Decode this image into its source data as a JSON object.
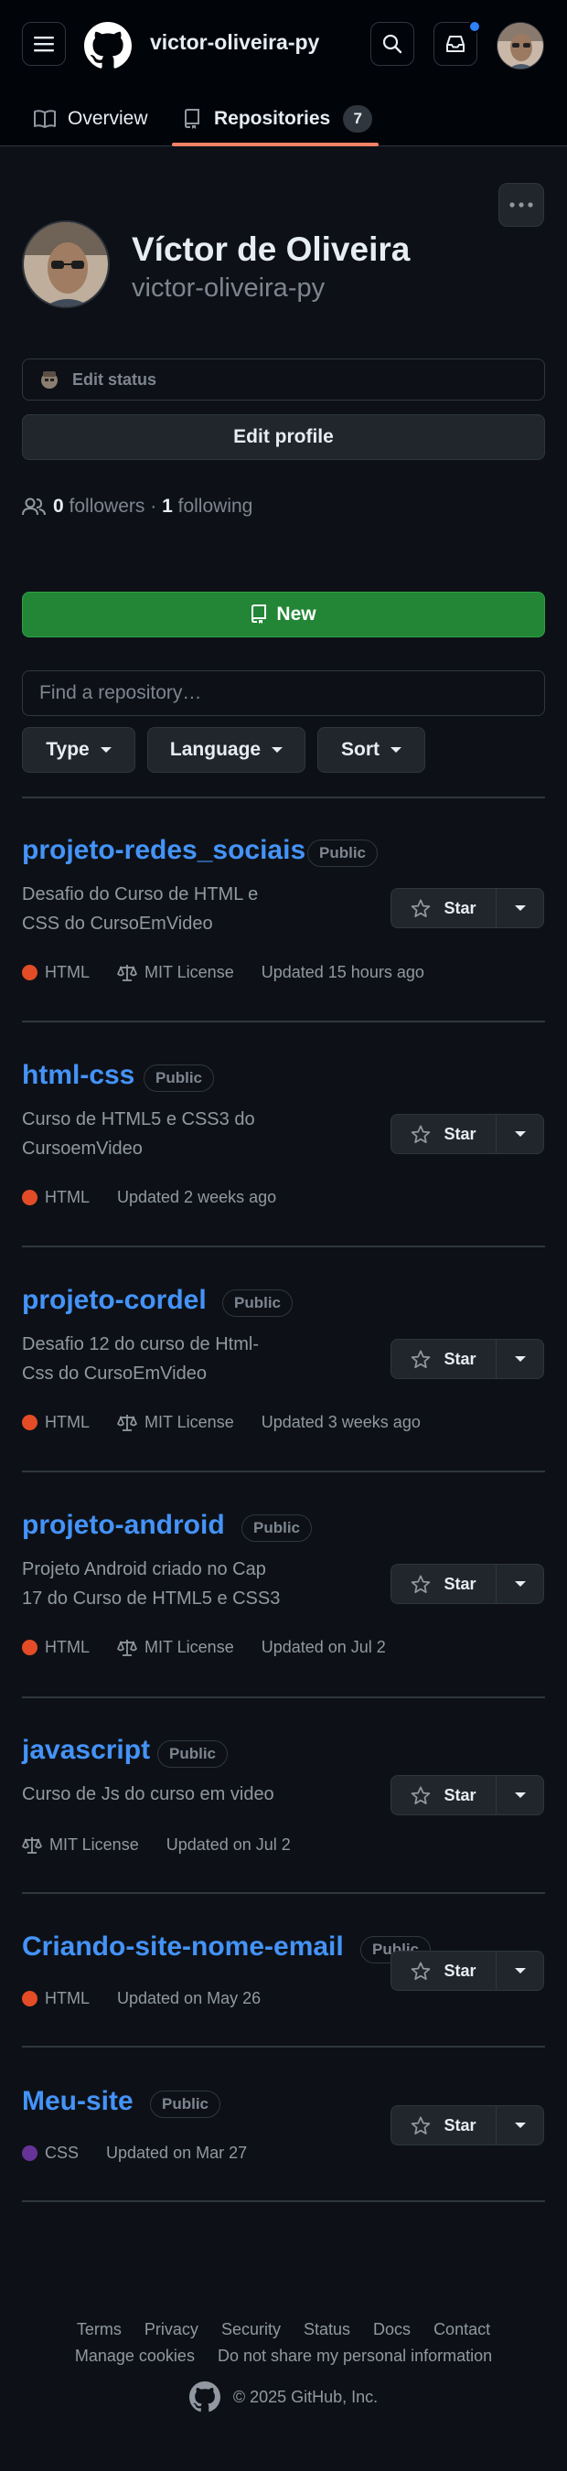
{
  "header": {
    "username": "victor-oliveira-py",
    "menu_icon": "hamburger-icon",
    "logo_icon": "github-logo-icon",
    "search_icon": "search-icon",
    "inbox_icon": "inbox-icon"
  },
  "tabs": {
    "overview": "Overview",
    "repositories": "Repositories",
    "repositories_count": "7"
  },
  "profile": {
    "full_name": "Víctor de Oliveira",
    "login": "victor-oliveira-py",
    "edit_status": "Edit status",
    "edit_profile": "Edit profile",
    "followers_count": "0",
    "followers_label": "followers",
    "separator": "·",
    "following_count": "1",
    "following_label": "following"
  },
  "repo_controls": {
    "new_label": "New",
    "find_placeholder": "Find a repository…",
    "type_label": "Type",
    "language_label": "Language",
    "sort_label": "Sort"
  },
  "repos": [
    {
      "name": "projeto-redes_sociais",
      "visibility": "Public",
      "desc1": "Desafio do Curso de HTML e",
      "desc2": "CSS do CursoEmVideo",
      "language": "HTML",
      "license": "MIT License",
      "updated": "Updated 15 hours ago"
    },
    {
      "name": "html-css",
      "visibility": "Public",
      "desc1": "Curso de HTML5 e CSS3 do",
      "desc2": "CursoemVideo",
      "language": "HTML",
      "license": "",
      "updated": "Updated 2 weeks ago"
    },
    {
      "name": "projeto-cordel",
      "visibility": "Public",
      "desc1": "Desafio 12 do curso de Html-",
      "desc2": "Css do CursoEmVideo",
      "language": "HTML",
      "license": "MIT License",
      "updated": "Updated 3 weeks ago"
    },
    {
      "name": "projeto-android",
      "visibility": "Public",
      "desc1": "Projeto Android criado no Cap",
      "desc2": "17 do Curso de HTML5 e CSS3",
      "language": "HTML",
      "license": "MIT License",
      "updated": "Updated on Jul 2"
    },
    {
      "name": "javascript",
      "visibility": "Public",
      "desc1": "Curso de Js do curso em video",
      "desc2": "",
      "language": "",
      "license": "MIT License",
      "updated": "Updated on Jul 2"
    },
    {
      "name": "Criando-site-nome-email",
      "visibility": "Public",
      "desc1": "",
      "desc2": "",
      "language": "HTML",
      "license": "",
      "updated": "Updated on May 26"
    },
    {
      "name": "Meu-site",
      "visibility": "Public",
      "desc1": "",
      "desc2": "",
      "language": "CSS",
      "license": "",
      "updated": "Updated on Mar 27"
    }
  ],
  "star_label": "Star",
  "colors": {
    "html": "#e34c26",
    "css": "#663399",
    "accent_blue": "#4493f8",
    "new_button_green": "#238636",
    "tab_underline": "#f78166"
  },
  "footer": {
    "terms": "Terms",
    "privacy": "Privacy",
    "security": "Security",
    "status": "Status",
    "docs": "Docs",
    "contact": "Contact",
    "manage_cookies": "Manage cookies",
    "do_not_share": "Do not share my personal information",
    "copyright": "© 2025 GitHub, Inc."
  }
}
